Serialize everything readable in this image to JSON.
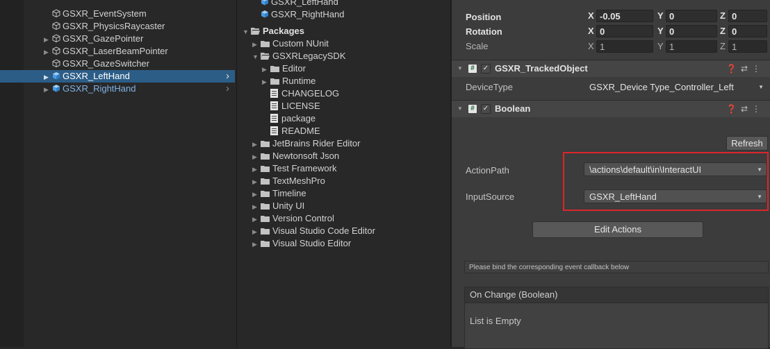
{
  "hierarchy": {
    "items": [
      {
        "label": "GSXR_EventSystem",
        "style": "plain",
        "arrow": false
      },
      {
        "label": "GSXR_PhysicsRaycaster",
        "style": "plain",
        "arrow": false
      },
      {
        "label": "GSXR_GazePointer",
        "style": "plain",
        "arrow": true
      },
      {
        "label": "GSXR_LaserBeamPointer",
        "style": "plain",
        "arrow": true
      },
      {
        "label": "GSXR_GazeSwitcher",
        "style": "plain",
        "arrow": false
      },
      {
        "label": "GSXR_LeftHand",
        "style": "selected",
        "arrow": true
      },
      {
        "label": "GSXR_RightHand",
        "style": "blue",
        "arrow": true
      }
    ]
  },
  "project": {
    "top_items": [
      {
        "label": "GSXR_LeftHand"
      },
      {
        "label": "GSXR_RightHand"
      }
    ],
    "packages_label": "Packages",
    "tree": [
      {
        "label": "Custom NUnit",
        "indent": 1,
        "type": "folder",
        "arrow": "right"
      },
      {
        "label": "GSXRLegacySDK",
        "indent": 1,
        "type": "folder-open",
        "arrow": "down"
      },
      {
        "label": "Editor",
        "indent": 2,
        "type": "folder",
        "arrow": "right"
      },
      {
        "label": "Runtime",
        "indent": 2,
        "type": "folder",
        "arrow": "right"
      },
      {
        "label": "CHANGELOG",
        "indent": 2,
        "type": "file",
        "arrow": "none"
      },
      {
        "label": "LICENSE",
        "indent": 2,
        "type": "file",
        "arrow": "none"
      },
      {
        "label": "package",
        "indent": 2,
        "type": "file",
        "arrow": "none"
      },
      {
        "label": "README",
        "indent": 2,
        "type": "file",
        "arrow": "none"
      },
      {
        "label": "JetBrains Rider Editor",
        "indent": 1,
        "type": "folder",
        "arrow": "right"
      },
      {
        "label": "Newtonsoft Json",
        "indent": 1,
        "type": "folder",
        "arrow": "right"
      },
      {
        "label": "Test Framework",
        "indent": 1,
        "type": "folder",
        "arrow": "right"
      },
      {
        "label": "TextMeshPro",
        "indent": 1,
        "type": "folder",
        "arrow": "right"
      },
      {
        "label": "Timeline",
        "indent": 1,
        "type": "folder",
        "arrow": "right"
      },
      {
        "label": "Unity UI",
        "indent": 1,
        "type": "folder",
        "arrow": "right"
      },
      {
        "label": "Version Control",
        "indent": 1,
        "type": "folder",
        "arrow": "right"
      },
      {
        "label": "Visual Studio Code Editor",
        "indent": 1,
        "type": "folder",
        "arrow": "right"
      },
      {
        "label": "Visual Studio Editor",
        "indent": 1,
        "type": "folder",
        "arrow": "right"
      }
    ]
  },
  "inspector": {
    "transform": {
      "position_label": "Position",
      "rotation_label": "Rotation",
      "scale_label": "Scale",
      "position": {
        "x": "-0.05",
        "y": "0",
        "z": "0"
      },
      "rotation": {
        "x": "0",
        "y": "0",
        "z": "0"
      },
      "scale": {
        "x": "1",
        "y": "1",
        "z": "1"
      },
      "axis_x": "X",
      "axis_y": "Y",
      "axis_z": "Z"
    },
    "tracked_object": {
      "title": "GSXR_TrackedObject",
      "device_type_label": "DeviceType",
      "device_type_value": "GSXR_Device Type_Controller_Left"
    },
    "boolean": {
      "title": "Boolean",
      "refresh_label": "Refresh",
      "action_path_label": "ActionPath",
      "action_path_value": "\\actions\\default\\in\\InteractUI",
      "input_source_label": "InputSource",
      "input_source_value": "GSXR_LeftHand",
      "edit_actions_label": "Edit Actions",
      "help_text": "Please bind the corresponding event callback below",
      "event_title": "On Change (Boolean)",
      "event_empty": "List is Empty"
    },
    "highlight_color": "#e0242b"
  }
}
